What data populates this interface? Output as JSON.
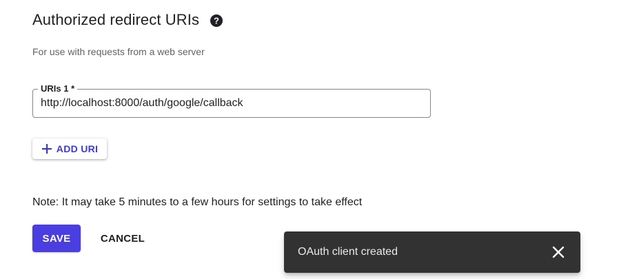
{
  "section": {
    "title": "Authorized redirect URIs",
    "help_icon": "help-circle-icon",
    "subtitle": "For use with requests from a web server"
  },
  "uri_field": {
    "label": "URIs 1 *",
    "value": "http://localhost:8000/auth/google/callback"
  },
  "add_uri": {
    "icon": "plus-icon",
    "label": "ADD URI"
  },
  "note": "Note: It may take 5 minutes to a few hours for settings to take effect",
  "actions": {
    "save_label": "SAVE",
    "cancel_label": "CANCEL"
  },
  "snackbar": {
    "message": "OAuth client created",
    "close_icon": "close-icon"
  },
  "colors": {
    "accent": "#4a3ee0",
    "link": "#3c3ad6",
    "snackbar_bg": "#323232"
  }
}
